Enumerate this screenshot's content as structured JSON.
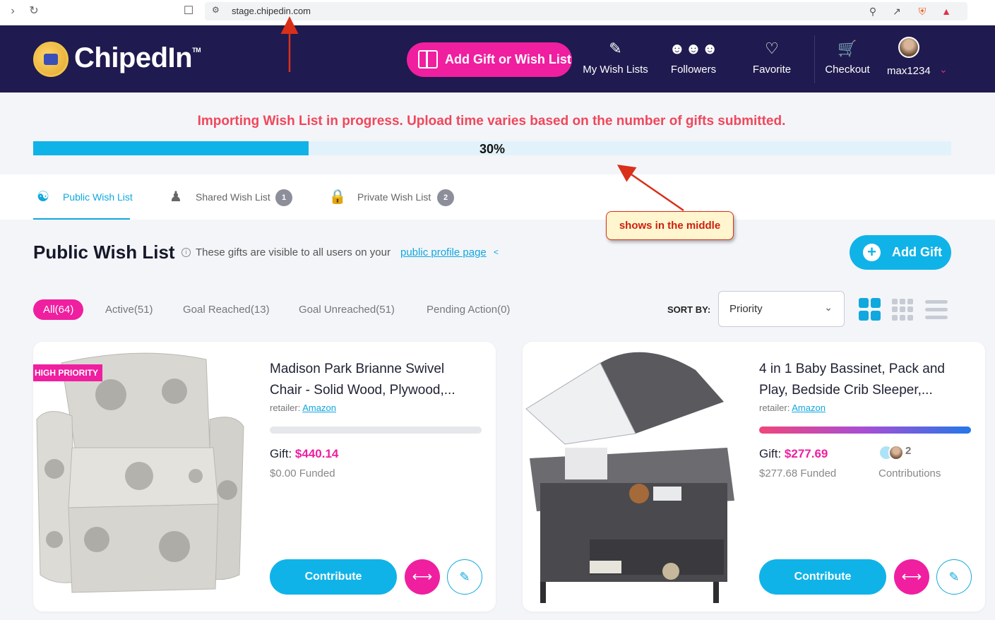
{
  "browser": {
    "url": "stage.chipedin.com"
  },
  "header": {
    "logo_text": "ChipedIn",
    "logo_tm": "TM",
    "add_gift_label": "Add Gift or Wish List",
    "nav": [
      {
        "label": "My Wish Lists",
        "icon": "wishlist-icon"
      },
      {
        "label": "Followers",
        "icon": "followers-icon"
      },
      {
        "label": "Favorite",
        "icon": "heart-icon"
      },
      {
        "label": "Checkout",
        "icon": "cart-icon"
      }
    ],
    "username": "max1234"
  },
  "progress": {
    "message": "Importing Wish List in progress. Upload time varies based on the number of gifts submitted.",
    "percent_label": "30%",
    "value": 0.3,
    "color": "#10b3e8"
  },
  "tabs": [
    {
      "label": "Public Wish List",
      "count": "",
      "icon": "group-icon",
      "active": true
    },
    {
      "label": "Shared Wish List",
      "count": "1",
      "icon": "shared-users-icon",
      "active": false
    },
    {
      "label": "Private Wish List",
      "count": "2",
      "icon": "lock-icon",
      "active": false
    }
  ],
  "annotation": {
    "callout": "shows in the middle"
  },
  "section": {
    "title": "Public Wish List",
    "note": "These gifts are visible to all users on your",
    "link": "public profile page",
    "add_gift": "Add Gift"
  },
  "filters": [
    {
      "label": "All",
      "count": "(64)",
      "active": true
    },
    {
      "label": "Active",
      "count": "(51)",
      "active": false
    },
    {
      "label": "Goal Reached",
      "count": "(13)",
      "active": false
    },
    {
      "label": "Goal Unreached",
      "count": "(51)",
      "active": false
    },
    {
      "label": "Pending Action",
      "count": "(0)",
      "active": false
    }
  ],
  "sort": {
    "label": "SORT BY:",
    "value": "Priority"
  },
  "cards": [
    {
      "badge": "HIGH PRIORITY",
      "title": "Madison Park Brianne Swivel Chair - Solid Wood, Plywood,...",
      "retailer_label": "retailer:",
      "retailer": "Amazon",
      "gift_label": "Gift:",
      "gift_amount": "$440.14",
      "funded": "$0.00 Funded",
      "progress": 0,
      "contributions_count": "",
      "contributions_label": "",
      "contribute": "Contribute"
    },
    {
      "badge": "",
      "title": "4 in 1 Baby Bassinet, Pack and Play, Bedside Crib Sleeper,...",
      "retailer_label": "retailer:",
      "retailer": "Amazon",
      "gift_label": "Gift:",
      "gift_amount": "$277.69",
      "funded": "$277.68 Funded",
      "progress": 1.0,
      "contributions_count": "2",
      "contributions_label": "Contributions",
      "contribute": "Contribute"
    }
  ],
  "colors": {
    "brand_navy": "#1f1a4f",
    "brand_pink": "#ef1fa0",
    "brand_cyan": "#10b3e8",
    "alert_red": "#f0475b"
  }
}
